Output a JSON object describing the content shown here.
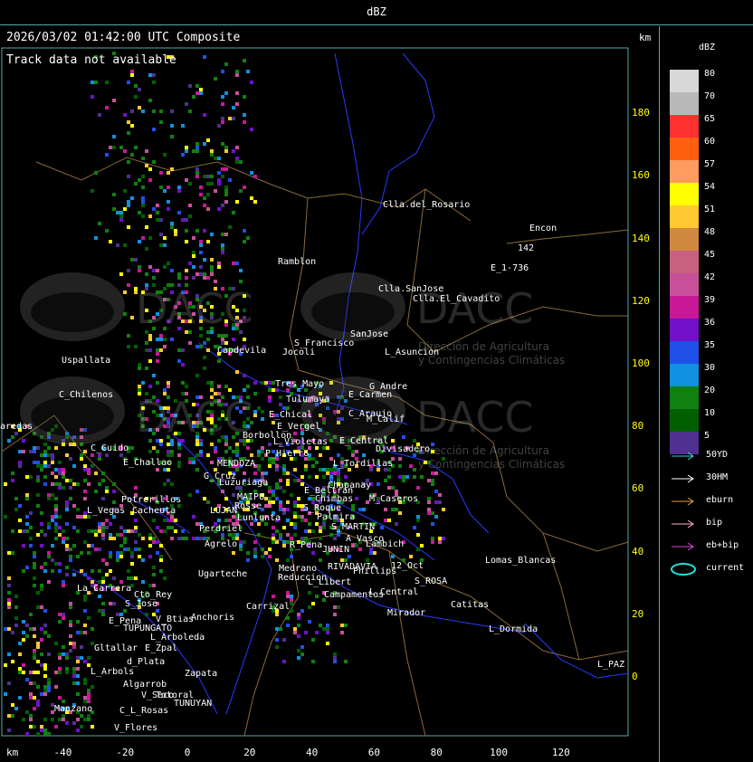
{
  "window": {
    "title": "dBZ"
  },
  "header": {
    "timestamp": "2026/03/02 01:42:00 UTC Composite",
    "track_status": "Track data not available",
    "km_top": "km",
    "km_bottom": "km"
  },
  "axes": {
    "y_ticks": [
      "180",
      "160",
      "140",
      "120",
      "100",
      "80",
      "60",
      "40",
      "20",
      "0"
    ],
    "x_ticks": [
      "-40",
      "-20",
      "0",
      "20",
      "40",
      "60",
      "80",
      "100",
      "120"
    ]
  },
  "places": [
    {
      "name": "Clla.del_Rosario"
    },
    {
      "name": "Encon"
    },
    {
      "name": "142"
    },
    {
      "name": "E_1-736"
    },
    {
      "name": "Ramblon"
    },
    {
      "name": "Clla.SanJose"
    },
    {
      "name": "Clla.El_Cavadito"
    },
    {
      "name": "S_Francisco"
    },
    {
      "name": "SanJose"
    },
    {
      "name": "Jocoli"
    },
    {
      "name": "L_Asuncion"
    },
    {
      "name": "Uspallata"
    },
    {
      "name": "Capdevila"
    },
    {
      "name": "Tres_Mayo"
    },
    {
      "name": "G_Andre"
    },
    {
      "name": "C_Chilenos"
    },
    {
      "name": "Tulumaya"
    },
    {
      "name": "E_Carmen"
    },
    {
      "name": "E_Chical"
    },
    {
      "name": "C_Araujo"
    },
    {
      "name": "M_Calif"
    },
    {
      "name": "E_Vergel"
    },
    {
      "name": "Borbollon"
    },
    {
      "name": "L_Violetas"
    },
    {
      "name": "E_Central"
    },
    {
      "name": "Divisadero"
    },
    {
      "name": "C_Guido"
    },
    {
      "name": "P_Hierro"
    },
    {
      "name": "E_Challao"
    },
    {
      "name": "MENDOZA"
    },
    {
      "name": "L_Tordillas"
    },
    {
      "name": "Chapanay"
    },
    {
      "name": "G_Cruz"
    },
    {
      "name": "Luzuriaga"
    },
    {
      "name": "E_Beltran"
    },
    {
      "name": "MAIPU"
    },
    {
      "name": "Chimbas"
    },
    {
      "name": "M_Caseros"
    },
    {
      "name": "Potrerillos"
    },
    {
      "name": "Rosse"
    },
    {
      "name": "S_Roque"
    },
    {
      "name": "L_Vegas"
    },
    {
      "name": "Cacheuta"
    },
    {
      "name": "LUJAN"
    },
    {
      "name": "Lunlunta"
    },
    {
      "name": "Palmira"
    },
    {
      "name": "Perdriel"
    },
    {
      "name": "S_MARTIN"
    },
    {
      "name": "A_Vasco"
    },
    {
      "name": "Agrelo"
    },
    {
      "name": "R_Pena"
    },
    {
      "name": "JUNIN"
    },
    {
      "name": "Lambich"
    },
    {
      "name": "Lomas_Blancas"
    },
    {
      "name": "Ugarteche"
    },
    {
      "name": "Medrano"
    },
    {
      "name": "RIVADAVIA"
    },
    {
      "name": "Phillips"
    },
    {
      "name": "12_Oct"
    },
    {
      "name": "Reduccion"
    },
    {
      "name": "L_Libert"
    },
    {
      "name": "S_ROSA"
    },
    {
      "name": "La_Carrera"
    },
    {
      "name": "Cto_Rey"
    },
    {
      "name": "Campamentos"
    },
    {
      "name": "L_Central"
    },
    {
      "name": "S_Jose"
    },
    {
      "name": "Carrizal"
    },
    {
      "name": "Catitas"
    },
    {
      "name": "Mirador"
    },
    {
      "name": "E_Pena"
    },
    {
      "name": "V_Btias"
    },
    {
      "name": "Anchoris"
    },
    {
      "name": "TUPUNGATO"
    },
    {
      "name": "L_Dormida"
    },
    {
      "name": "L_Arboleda"
    },
    {
      "name": "Gltallar"
    },
    {
      "name": "E_Zpal"
    },
    {
      "name": "d_Plata"
    },
    {
      "name": "L_PAZ"
    },
    {
      "name": "L_Arbols"
    },
    {
      "name": "Zapata"
    },
    {
      "name": "Algarrob"
    },
    {
      "name": "V_Seco"
    },
    {
      "name": "Totoral"
    },
    {
      "name": "TUNUYAN"
    },
    {
      "name": "Manzano"
    },
    {
      "name": "C_L_Rosas"
    },
    {
      "name": "V_Flores"
    },
    {
      "name": "aredas"
    }
  ],
  "legend": {
    "title": "dBZ",
    "levels": [
      {
        "value": "80",
        "color": "#d8d8d8"
      },
      {
        "value": "70",
        "color": "#b8b8b8"
      },
      {
        "value": "65",
        "color": "#ff3030"
      },
      {
        "value": "60",
        "color": "#ff6010"
      },
      {
        "value": "57",
        "color": "#ff9a60"
      },
      {
        "value": "54",
        "color": "#ffff00"
      },
      {
        "value": "51",
        "color": "#ffc830"
      },
      {
        "value": "48",
        "color": "#d08840"
      },
      {
        "value": "45",
        "color": "#c86080"
      },
      {
        "value": "42",
        "color": "#c8509a"
      },
      {
        "value": "39",
        "color": "#c81898"
      },
      {
        "value": "36",
        "color": "#7010c8"
      },
      {
        "value": "35",
        "color": "#2050e8"
      },
      {
        "value": "30",
        "color": "#1090e0"
      },
      {
        "value": "20",
        "color": "#108010"
      },
      {
        "value": "10",
        "color": "#006000"
      },
      {
        "value": "5",
        "color": "#503090"
      }
    ],
    "tracks": [
      {
        "label": "50YD",
        "color": "#40d0d0"
      },
      {
        "label": "30HM",
        "color": "#ffffff"
      },
      {
        "label": "eburn",
        "color": "#e0a040"
      },
      {
        "label": "bip",
        "color": "#ffb0c0"
      },
      {
        "label": "eb+bip",
        "color": "#e040e0"
      },
      {
        "label": "current",
        "color": "#20e0e0"
      }
    ]
  },
  "watermark": {
    "brand": "DACC",
    "subtitle_1": "Dirección de Agricultura",
    "subtitle_2": "y Contingencias Climáticas"
  }
}
